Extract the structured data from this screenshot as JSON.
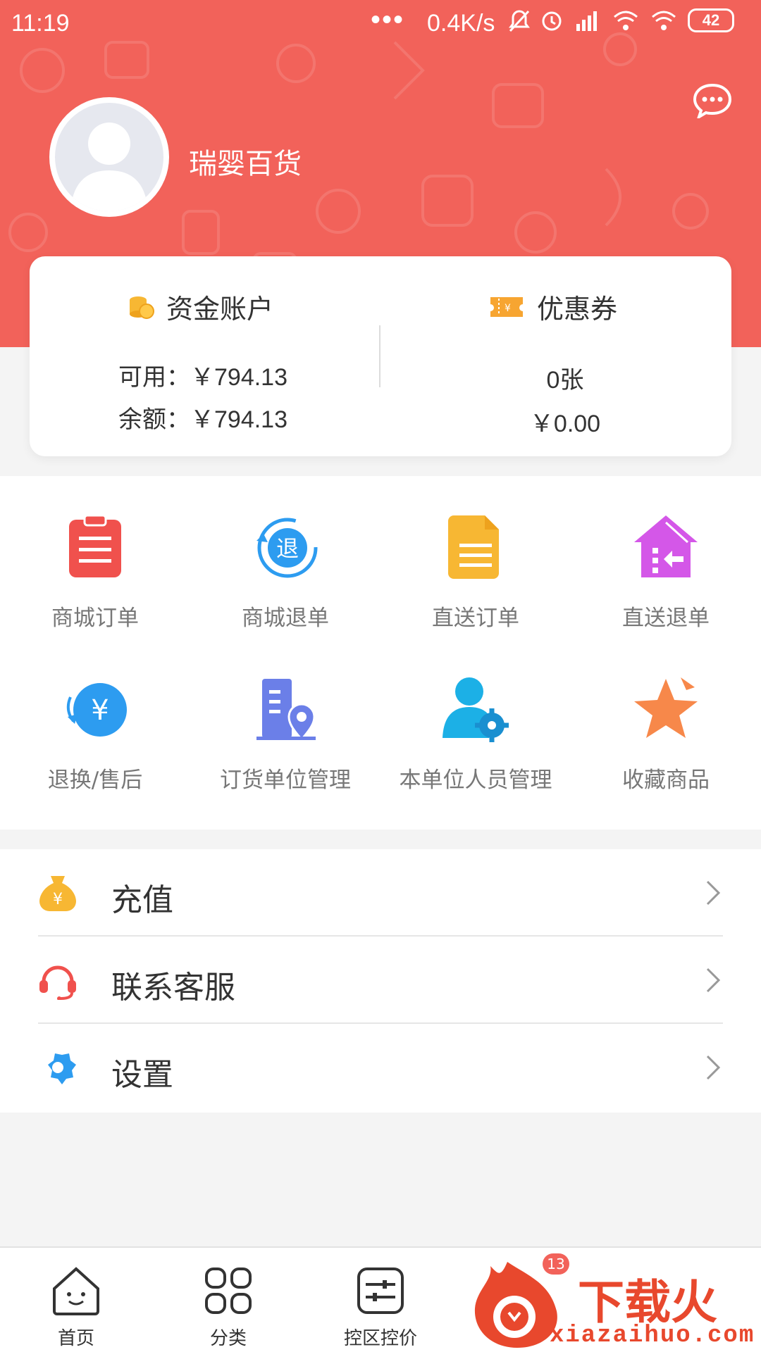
{
  "status_bar": {
    "time": "11:19",
    "dots": "•••",
    "net_speed": "0.4K/s",
    "battery": "42"
  },
  "profile": {
    "name": "瑞婴百货"
  },
  "account": {
    "title": "资金账户",
    "available": "可用：￥794.13",
    "balance": "余额：￥794.13"
  },
  "coupon": {
    "title": "优惠券",
    "count": "0张",
    "amount": "￥0.00"
  },
  "grid": [
    {
      "label": "商城订单",
      "icon": "mall-order-icon"
    },
    {
      "label": "商城退单",
      "icon": "mall-refund-icon"
    },
    {
      "label": "直送订单",
      "icon": "direct-order-icon"
    },
    {
      "label": "直送退单",
      "icon": "direct-refund-icon"
    },
    {
      "label": "退换/售后",
      "icon": "after-sale-icon"
    },
    {
      "label": "订货单位管理",
      "icon": "ordering-unit-icon"
    },
    {
      "label": "本单位人员管理",
      "icon": "staff-management-icon"
    },
    {
      "label": "收藏商品",
      "icon": "favorites-icon"
    }
  ],
  "menu": [
    {
      "label": "充值",
      "icon": "recharge-icon"
    },
    {
      "label": "联系客服",
      "icon": "customer-service-icon"
    },
    {
      "label": "设置",
      "icon": "settings-icon"
    }
  ],
  "tabs": [
    {
      "label": "首页",
      "icon": "home-icon"
    },
    {
      "label": "分类",
      "icon": "category-icon"
    },
    {
      "label": "控区控价",
      "icon": "price-control-icon"
    }
  ],
  "cart_badge": "13",
  "watermark": {
    "text": "下载火",
    "url": "xiazaihuo.com"
  },
  "colors": {
    "header": "#f2625a",
    "accent_blue": "#2d9cf0",
    "orange": "#f7a531"
  }
}
